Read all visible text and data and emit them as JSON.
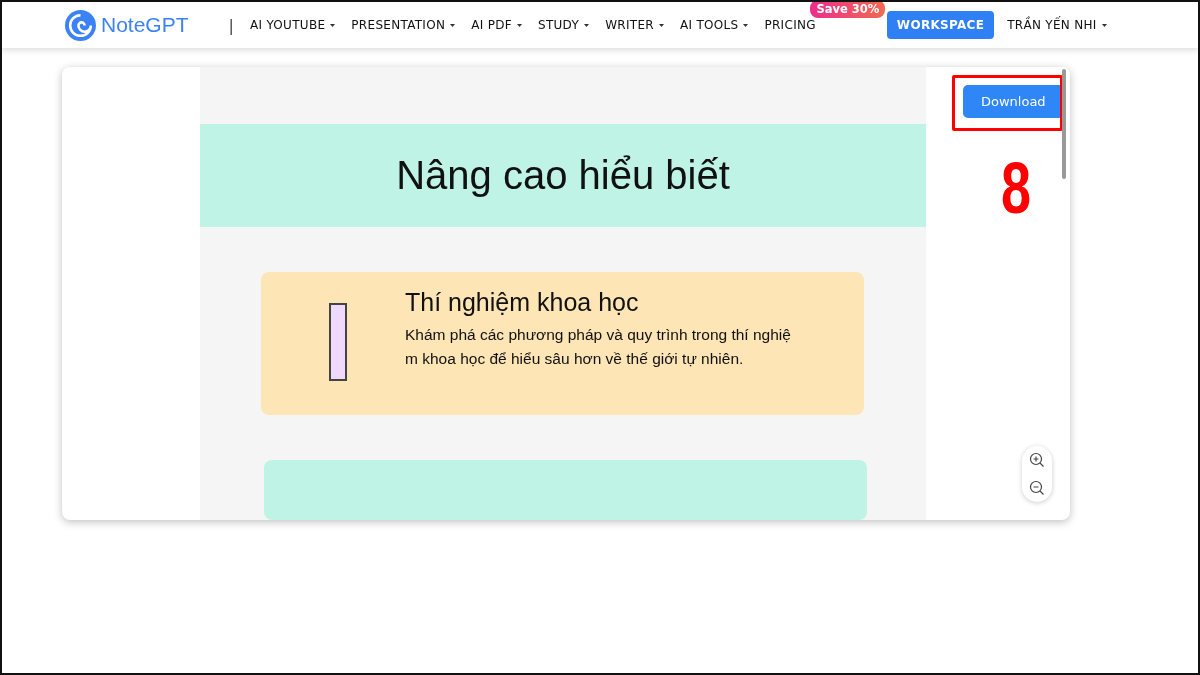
{
  "nav": {
    "brand": "NoteGPT",
    "separator": "|",
    "items": [
      {
        "label": "AI YOUTUBE",
        "dropdown": true
      },
      {
        "label": "PRESENTATION",
        "dropdown": true
      },
      {
        "label": "AI PDF",
        "dropdown": true
      },
      {
        "label": "STUDY",
        "dropdown": true
      },
      {
        "label": "WRITER",
        "dropdown": true
      },
      {
        "label": "AI TOOLS",
        "dropdown": true
      },
      {
        "label": "PRICING",
        "badge": "Save 30%"
      }
    ],
    "workspace": "WORKSPACE",
    "user": "TRẦN YẾN NHI"
  },
  "slide": {
    "title": "Nâng cao hiểu biết",
    "cards": [
      {
        "heading": "Thí nghiệm khoa học",
        "text": "Khám phá các phương pháp và quy trình trong thí nghiệ\nm khoa học để hiểu sâu hơn về thế giới tự nhiên.",
        "color": "#fde5b5"
      },
      {
        "color": "#bff3e5"
      }
    ]
  },
  "download": "Download",
  "annotation": {
    "step": "8",
    "highlight": true
  }
}
